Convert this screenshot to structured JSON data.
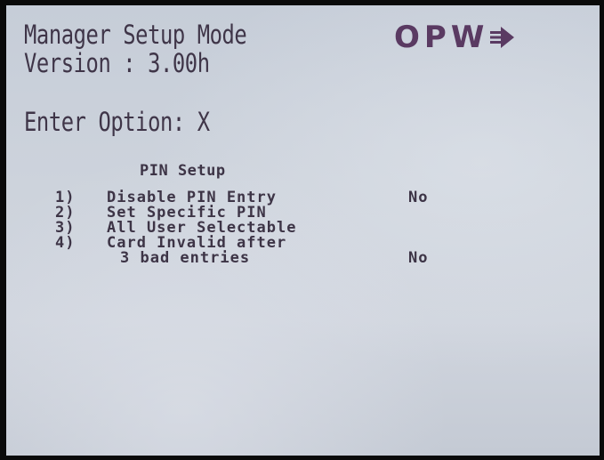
{
  "header": {
    "mode": "Manager Setup Mode",
    "version": "Version : 3.00h",
    "prompt": "Enter Option: X"
  },
  "logo": {
    "text": "OPW",
    "icon": "arrow-right-icon",
    "color": "#5a3a62"
  },
  "menu": {
    "title": "PIN Setup",
    "options": [
      {
        "number": "1)",
        "label": "Disable PIN Entry",
        "value": "No"
      },
      {
        "number": "2)",
        "label": "Set Specific PIN",
        "value": ""
      },
      {
        "number": "3)",
        "label": "All User Selectable",
        "value": ""
      },
      {
        "number": "4)",
        "label": "Card Invalid after",
        "sublabel": "3 bad entries",
        "value": "No"
      }
    ]
  },
  "colors": {
    "screen_bg": "#cdd3dc",
    "text": "#3d3446"
  }
}
